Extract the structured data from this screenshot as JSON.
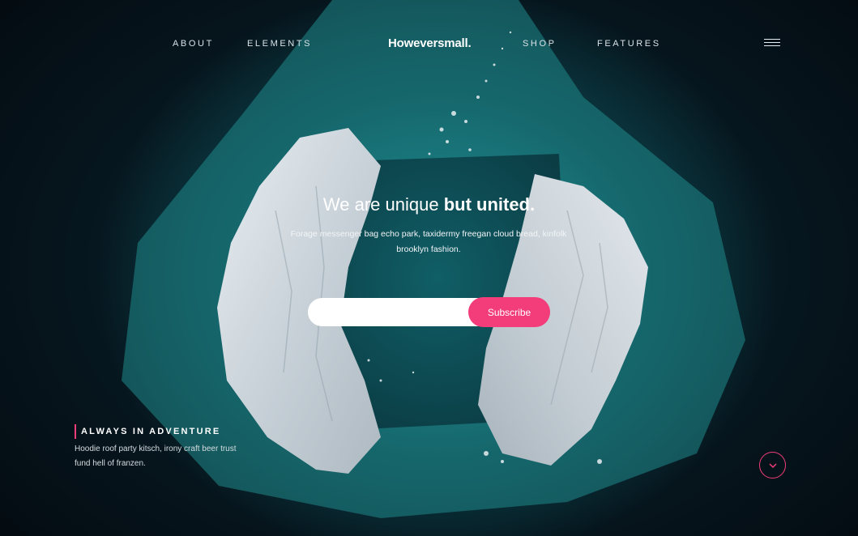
{
  "nav": {
    "left": [
      "ABOUT",
      "ELEMENTS"
    ],
    "logo": "Howeversmall.",
    "right": [
      "SHOP",
      "FEATURES"
    ],
    "menu_icon": "hamburger-icon"
  },
  "hero": {
    "headline_regular": "We are unique ",
    "headline_bold": "but united.",
    "subtext": "Forage messenger bag echo park, taxidermy freegan cloud bread, kinfolk brooklyn fashion.",
    "subscribe": {
      "placeholder": "",
      "button_label": "Subscribe"
    }
  },
  "feature": {
    "title": "ALWAYS IN ADVENTURE",
    "text": "Hoodie roof party kitsch, irony craft beer trust fund hell of franzen."
  },
  "scroll_icon": "chevron-down-icon",
  "colors": {
    "accent": "#f23d7a",
    "background": "#05121a",
    "water": "#1b7d82"
  }
}
